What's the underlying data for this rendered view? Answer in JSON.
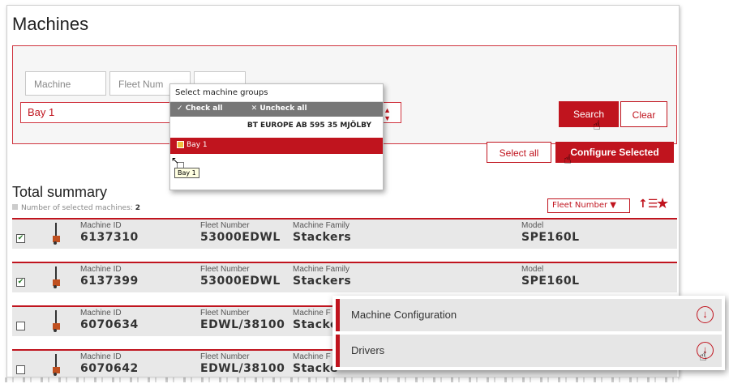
{
  "page": {
    "title": "Machines"
  },
  "filters": {
    "machine_placeholder": "Machine",
    "fleet_placeholder": "Fleet Num",
    "group_value": "Bay 1",
    "search_label": "Search",
    "clear_label": "Clear",
    "select_all_label": "Select all",
    "configure_label": "Configure Selected"
  },
  "dropdown": {
    "header": "Select machine groups",
    "check_all": "Check all",
    "uncheck_all": "Uncheck all",
    "group_name": "BT EUROPE AB 595 35 MJÖLBY",
    "selected_option": "Bay 1",
    "tooltip": "Bay 1"
  },
  "summary": {
    "title": "Total summary",
    "selected_label": "Number of selected machines:",
    "selected_count": "2",
    "sort_by": "Fleet Number"
  },
  "labels": {
    "machine_id": "Machine ID",
    "fleet_number": "Fleet Number",
    "machine_family": "Machine Family",
    "machine_family_short": "Machine F",
    "model": "Model"
  },
  "rows": [
    {
      "id": "6137310",
      "fleet": "53000EDWL",
      "family": "Stackers",
      "model": "SPE160L",
      "checked": true
    },
    {
      "id": "6137399",
      "fleet": "53000EDWL",
      "family": "Stackers",
      "model": "SPE160L",
      "checked": true
    },
    {
      "id": "6070634",
      "fleet": "EDWL/38100",
      "family": "Stacke",
      "model": "",
      "checked": false
    },
    {
      "id": "6070642",
      "fleet": "EDWL/38100",
      "family": "Stacke",
      "model": "",
      "checked": false
    }
  ],
  "context_menu": {
    "items": [
      "Machine Configuration",
      "Drivers"
    ]
  },
  "colors": {
    "accent": "#c0141e",
    "row_bg": "#e8e8e8"
  },
  "icons": [
    "sort-icon",
    "star-icon",
    "download-circle-icon",
    "pointer-hand-icon",
    "forklift-icon"
  ]
}
